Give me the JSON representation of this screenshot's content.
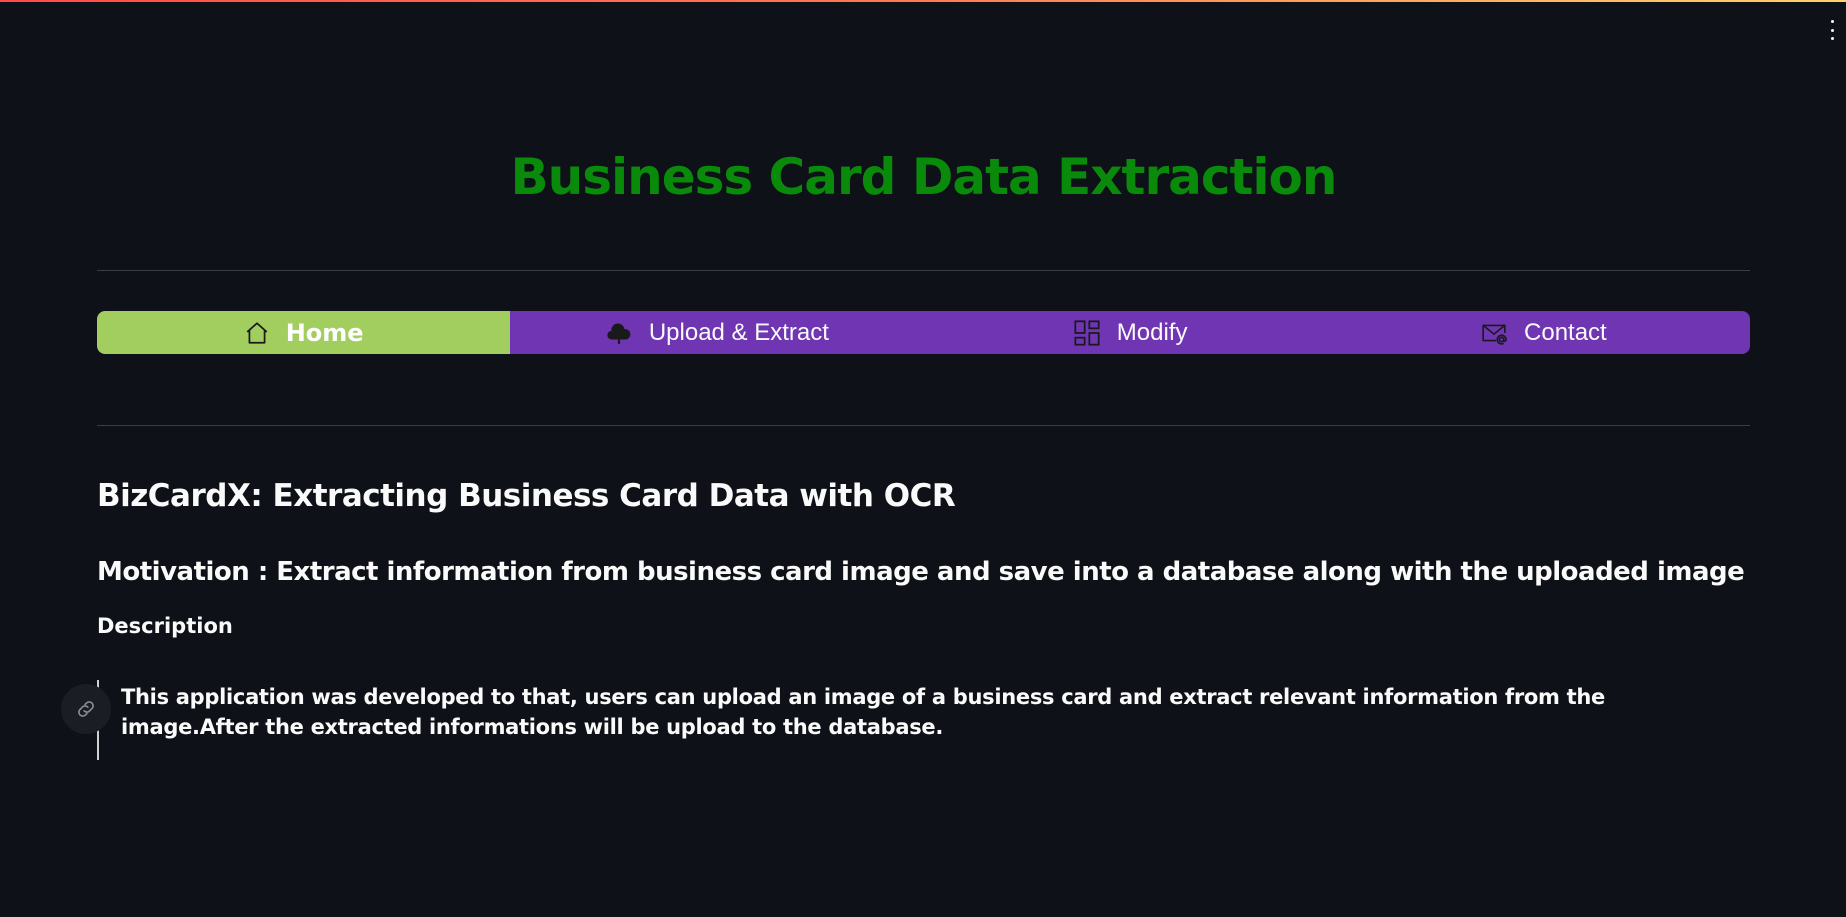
{
  "app": {
    "title": "Business Card Data Extraction"
  },
  "nav": {
    "items": [
      {
        "label": "Home",
        "icon": "home-icon",
        "active": true
      },
      {
        "label": "Upload & Extract",
        "icon": "cloud-upload-icon",
        "active": false
      },
      {
        "label": "Modify",
        "icon": "dashboard-grid-icon",
        "active": false
      },
      {
        "label": "Contact",
        "icon": "envelope-at-icon",
        "active": false
      }
    ],
    "active_color": "#a2cd5f",
    "bar_color": "#6f35b3"
  },
  "content": {
    "heading": "BizCardX: Extracting Business Card Data with OCR",
    "motivation": "Motivation : Extract information from business card image and save into a database along with the uploaded image",
    "description_label": "Description",
    "description_text": "This application was developed to that, users can upload an image of a business card and extract relevant information from the image.After the extracted informations will be upload to the database."
  },
  "colors": {
    "background": "#0e1117",
    "title": "#0a8a0a"
  }
}
